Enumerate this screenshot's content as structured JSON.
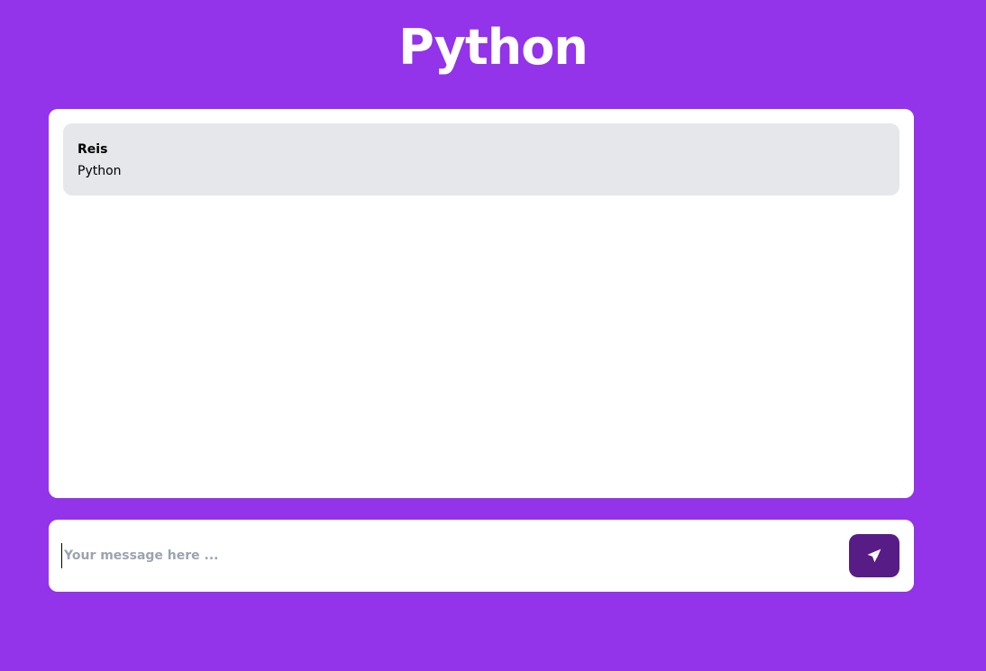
{
  "header": {
    "title": "Python"
  },
  "chat": {
    "messages": [
      {
        "author": "Reis",
        "text": "Python"
      }
    ]
  },
  "composer": {
    "placeholder": "Your message here ...",
    "value": "",
    "send_icon": "paper-plane-icon"
  },
  "colors": {
    "background": "#9333ea",
    "panel": "#ffffff",
    "message_bubble": "#e5e7eb",
    "send_button": "#581c87"
  }
}
